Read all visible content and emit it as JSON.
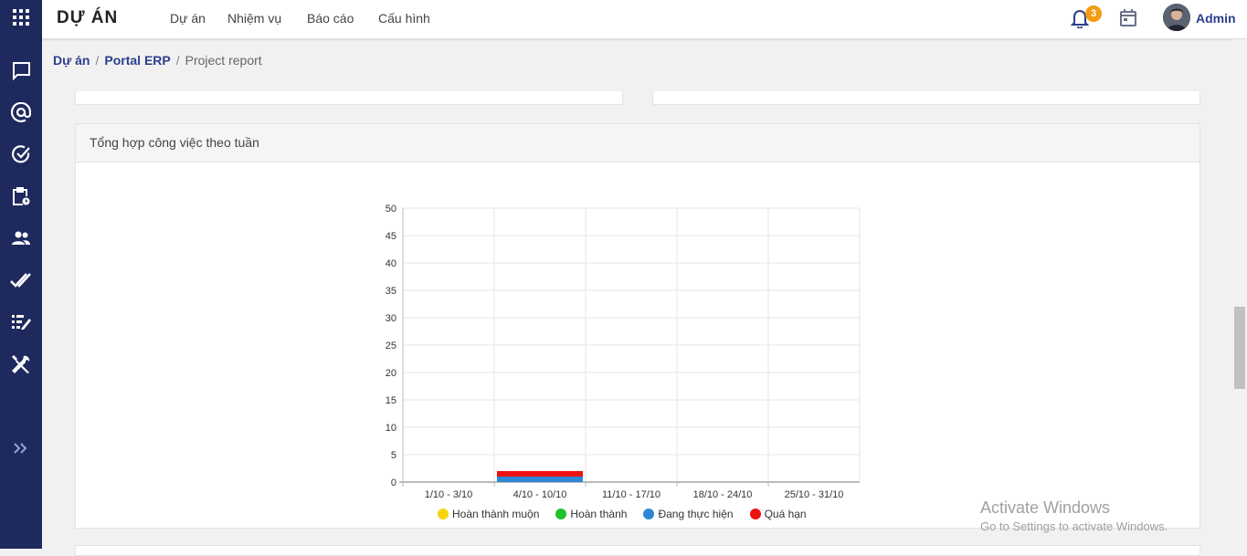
{
  "app": {
    "title": "DỰ ÁN"
  },
  "nav": [
    "Dự án",
    "Nhiệm vụ",
    "Báo cáo",
    "Cấu hình"
  ],
  "notifications": {
    "count": "3"
  },
  "user": {
    "name": "Admin"
  },
  "breadcrumb": {
    "items": [
      "Dự án",
      "Portal ERP",
      "Project report"
    ],
    "separator": "/"
  },
  "sidebar": {
    "icons": [
      "apps-grid-icon",
      "chat-icon",
      "at-sign-icon",
      "check-circle-icon",
      "clipboard-clock-icon",
      "people-icon",
      "double-check-icon",
      "checklist-icon",
      "tools-icon",
      "expand-chevrons-icon"
    ]
  },
  "card": {
    "title": "Tổng hợp công việc theo tuần"
  },
  "colors": {
    "sidebar": "#1e2a5e",
    "accent": "#2c3e8c",
    "badge": "#f39c12"
  },
  "chart_data": {
    "type": "bar",
    "stacked": true,
    "categories": [
      "1/10 - 3/10",
      "4/10 - 10/10",
      "11/10 - 17/10",
      "18/10 - 24/10",
      "25/10 - 31/10"
    ],
    "series": [
      {
        "name": "Hoàn thành muộn",
        "color": "#f5d60c",
        "values": [
          0,
          0,
          0,
          0,
          0
        ]
      },
      {
        "name": "Hoàn thành",
        "color": "#1fc12c",
        "values": [
          0,
          0,
          0,
          0,
          0
        ]
      },
      {
        "name": "Đang thực hiện",
        "color": "#2f86d6",
        "values": [
          0,
          1,
          0,
          0,
          0
        ]
      },
      {
        "name": "Quá hạn",
        "color": "#ee1111",
        "values": [
          0,
          1,
          0,
          0,
          0
        ]
      }
    ],
    "ylim": [
      0,
      50
    ],
    "yticks": [
      0,
      5,
      10,
      15,
      20,
      25,
      30,
      35,
      40,
      45,
      50
    ],
    "grid": true,
    "legend": "bottom"
  },
  "watermark": {
    "line1": "Activate Windows",
    "line2": "Go to Settings to activate Windows."
  }
}
